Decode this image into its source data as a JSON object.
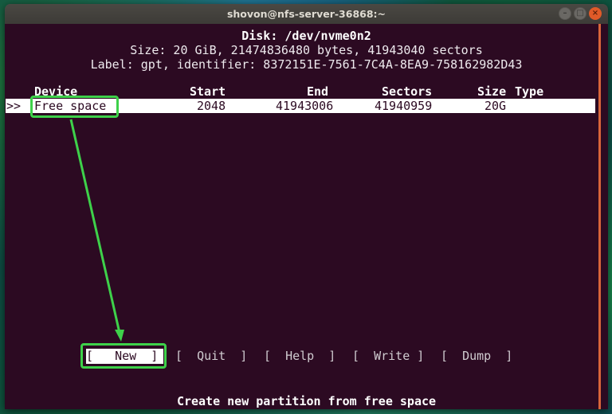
{
  "window": {
    "title": "shovon@nfs-server-36868:~",
    "controls": {
      "minimize": "–",
      "maximize": "□",
      "close": "×"
    }
  },
  "disk_info": {
    "disk_line": "Disk: /dev/nvme0n2",
    "size_line": "Size: 20 GiB, 21474836480 bytes, 41943040 sectors",
    "label_line": "Label: gpt, identifier: 8372151E-7561-7C4A-8EA9-758162982D43"
  },
  "table": {
    "headers": {
      "device": "Device",
      "start": "Start",
      "end": "End",
      "sectors": "Sectors",
      "size": "Size",
      "type": "Type"
    },
    "rows": [
      {
        "cursor": ">>",
        "device": "Free space",
        "start": "2048",
        "end": "41943006",
        "sectors": "41940959",
        "size": "20G",
        "type": ""
      }
    ]
  },
  "menu": {
    "buttons": [
      {
        "label": "[   New  ]",
        "selected": true
      },
      {
        "label": "[  Quit  ]",
        "selected": false
      },
      {
        "label": "[  Help  ]",
        "selected": false
      },
      {
        "label": "[  Write ]",
        "selected": false
      },
      {
        "label": "[  Dump  ]",
        "selected": false
      }
    ]
  },
  "status_text": "Create new partition from free space",
  "colors": {
    "terminal_bg": "#2c0a22",
    "annotation": "#3ed14a",
    "scrollbar": "#d8653a",
    "close_button": "#e05a28"
  }
}
